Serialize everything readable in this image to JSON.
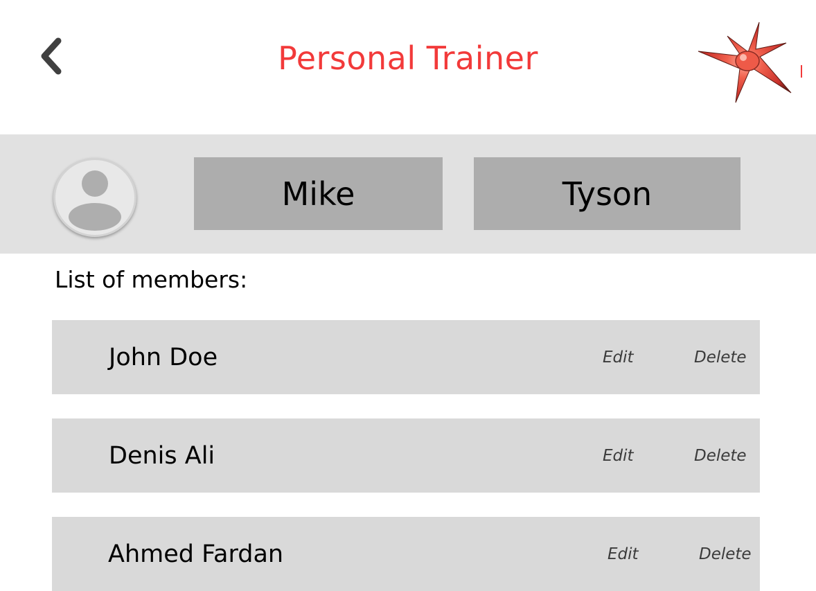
{
  "header": {
    "title": "Personal Trainer",
    "back_icon": "chevron-left-icon",
    "logo_icon": "red-starburst-logo"
  },
  "trainer": {
    "avatar_icon": "user-avatar-icon",
    "first_name": "Mike",
    "last_name": "Tyson"
  },
  "members": {
    "heading": "List of members:",
    "items": [
      {
        "name": "John Doe",
        "edit_label": "Edit",
        "delete_label": "Delete"
      },
      {
        "name": "Denis Ali",
        "edit_label": "Edit",
        "delete_label": "Delete"
      },
      {
        "name": "Ahmed Fardan",
        "edit_label": "Edit",
        "delete_label": "Delete"
      }
    ]
  },
  "colors": {
    "title": "#f23a3a",
    "profile_band": "#e1e1e1",
    "name_box": "#adadad",
    "row_background": "#d9d9d9"
  }
}
